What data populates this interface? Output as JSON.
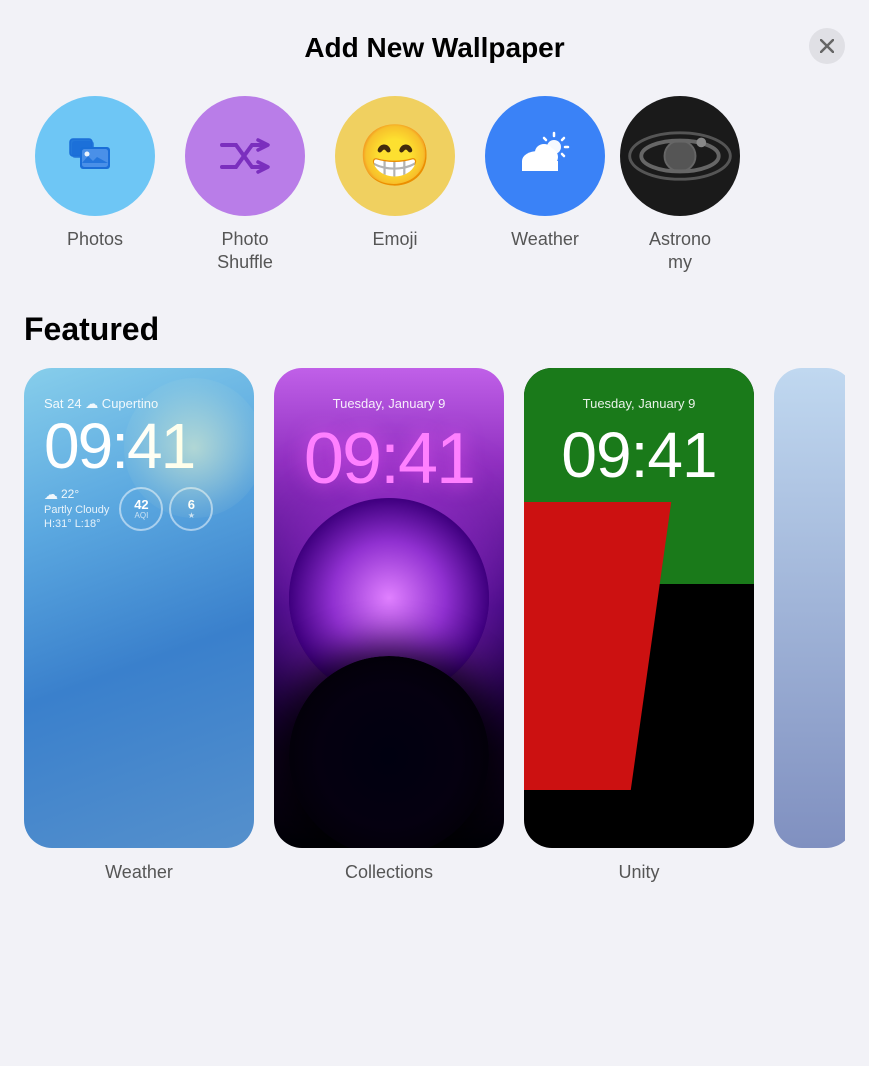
{
  "header": {
    "title": "Add New Wallpaper",
    "close_label": "×"
  },
  "categories": [
    {
      "id": "photos",
      "label": "Photos",
      "bg": "photos-bg",
      "icon_type": "photos"
    },
    {
      "id": "photo-shuffle",
      "label": "Photo\nShuffle",
      "bg": "shuffle-bg",
      "icon_type": "shuffle"
    },
    {
      "id": "emoji",
      "label": "Emoji",
      "bg": "emoji-bg",
      "icon_type": "emoji",
      "emoji": "😁"
    },
    {
      "id": "weather",
      "label": "Weather",
      "bg": "weather-bg",
      "icon_type": "weather"
    },
    {
      "id": "astronomy",
      "label": "Astronomy",
      "bg": "astro-bg",
      "icon_type": "astro"
    }
  ],
  "featured_title": "Featured",
  "featured_cards": [
    {
      "id": "weather-card",
      "label": "Weather",
      "date": "Sat 24 ☁ Cupertino",
      "time": "09:41",
      "temp": "22°",
      "condition": "Partly Cloudy",
      "hi_lo": "H:31° L:18°",
      "badge1_num": "42",
      "badge1_label": "AQI",
      "badge2_num": "6",
      "badge2_label": "★"
    },
    {
      "id": "collections-card",
      "label": "Collections",
      "date": "Tuesday, January 9",
      "time": "09:41"
    },
    {
      "id": "unity-card",
      "label": "Unity",
      "date": "Tuesday, January 9",
      "time": "09:41"
    }
  ]
}
